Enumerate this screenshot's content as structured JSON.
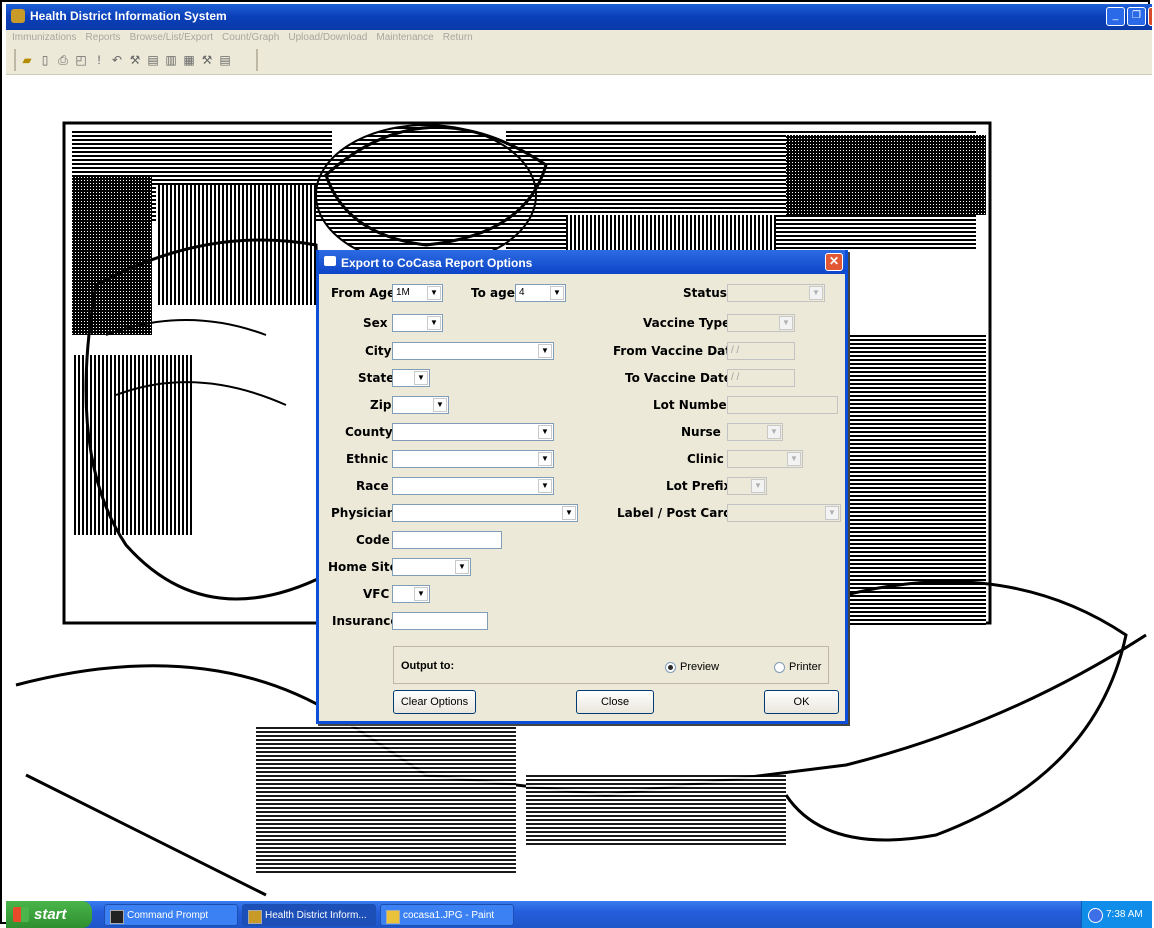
{
  "window": {
    "title": "Health District Information System"
  },
  "menu": [
    "Immunizations",
    "Reports",
    "Browse/List/Export",
    "Count/Graph",
    "Upload/Download",
    "Maintenance",
    "Return"
  ],
  "toolbar_icons": [
    "open-icon",
    "new-icon",
    "print-icon",
    "preview-icon",
    "run-icon",
    "undo-icon",
    "tools-icon",
    "paste-icon",
    "copy-icon",
    "table-icon",
    "tools2-icon",
    "paste2-icon"
  ],
  "dialog": {
    "title": "Export to CoCasa Report Options",
    "left": {
      "from_age_label": "From Age",
      "from_age_value": "1M",
      "to_age_label": "To age",
      "to_age_value": "4",
      "sex_label": "Sex",
      "sex_value": "",
      "city_label": "City",
      "city_value": "",
      "state_label": "State",
      "state_value": "",
      "zip_label": "Zip",
      "zip_value": "",
      "county_label": "County",
      "county_value": "",
      "ethnic_label": "Ethnic",
      "ethnic_value": "",
      "race_label": "Race",
      "race_value": "",
      "physician_label": "Physician",
      "physician_value": "",
      "code_label": "Code",
      "code_value": "",
      "home_site_label": "Home Site",
      "home_site_value": "",
      "vfc_label": "VFC",
      "vfc_value": "",
      "insurance_label": "Insurance",
      "insurance_value": ""
    },
    "right": {
      "status_label": "Status",
      "status_value": "",
      "vaccine_type_label": "Vaccine Type",
      "vaccine_type_value": "",
      "from_vaccine_date_label": "From Vaccine Date",
      "from_vaccine_date_value": "/ /",
      "to_vaccine_date_label": "To Vaccine Date",
      "to_vaccine_date_value": "/ /",
      "lot_number_label": "Lot Number",
      "lot_number_value": "",
      "nurse_label": "Nurse",
      "nurse_value": "",
      "clinic_label": "Clinic",
      "clinic_value": "",
      "lot_prefix_label": "Lot Prefix",
      "lot_prefix_value": "",
      "label_post_cards_label": "Label / Post Cards",
      "label_post_cards_value": ""
    },
    "output": {
      "label": "Output to:",
      "preview": "Preview",
      "printer": "Printer",
      "selected": "Preview"
    },
    "buttons": {
      "clear": "Clear Options",
      "close": "Close",
      "ok": "OK"
    }
  },
  "taskbar": {
    "start": "start",
    "tasks": [
      "Command Prompt",
      "Health District Inform...",
      "cocasa1.JPG - Paint"
    ],
    "clock": "7:38 AM"
  },
  "colors": {
    "titlebar": "#0a3fb8",
    "dialog_bg": "#ece9d8",
    "taskbar": "#245edb",
    "start": "#2e8f2e"
  }
}
